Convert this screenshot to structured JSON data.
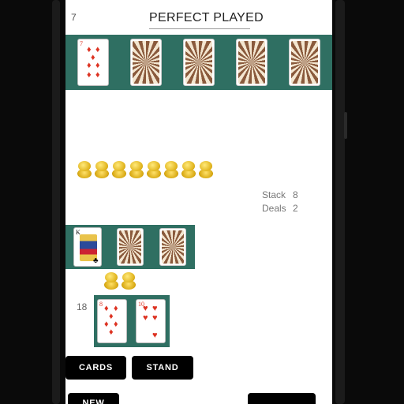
{
  "header": {
    "score": "7",
    "title": "PERFECT PLAYED"
  },
  "dealer": {
    "cards": [
      {
        "rank": "7",
        "suit": "♦",
        "color": "red",
        "face_up": true
      },
      {
        "face_up": false
      },
      {
        "face_up": false
      },
      {
        "face_up": false
      },
      {
        "face_up": false
      }
    ]
  },
  "chips_top_count": 8,
  "stats": {
    "stack_label": "Stack",
    "stack_value": "8",
    "deals_label": "Deals",
    "deals_value": "2"
  },
  "player_top": {
    "cards": [
      {
        "rank": "K",
        "suit": "♣",
        "color": "black",
        "face_up": true
      },
      {
        "face_up": false
      },
      {
        "face_up": false
      }
    ]
  },
  "chips_bet_count": 2,
  "player_hand": {
    "value": "18",
    "cards": [
      {
        "rank": "8",
        "suit": "♦",
        "color": "red"
      },
      {
        "rank": "10",
        "suit": "♥",
        "color": "red"
      }
    ]
  },
  "buttons": {
    "cards": "CARDS",
    "stand": "STAND",
    "new": "NEW"
  },
  "colors": {
    "felt": "#2f6f62",
    "button": "#000000"
  }
}
